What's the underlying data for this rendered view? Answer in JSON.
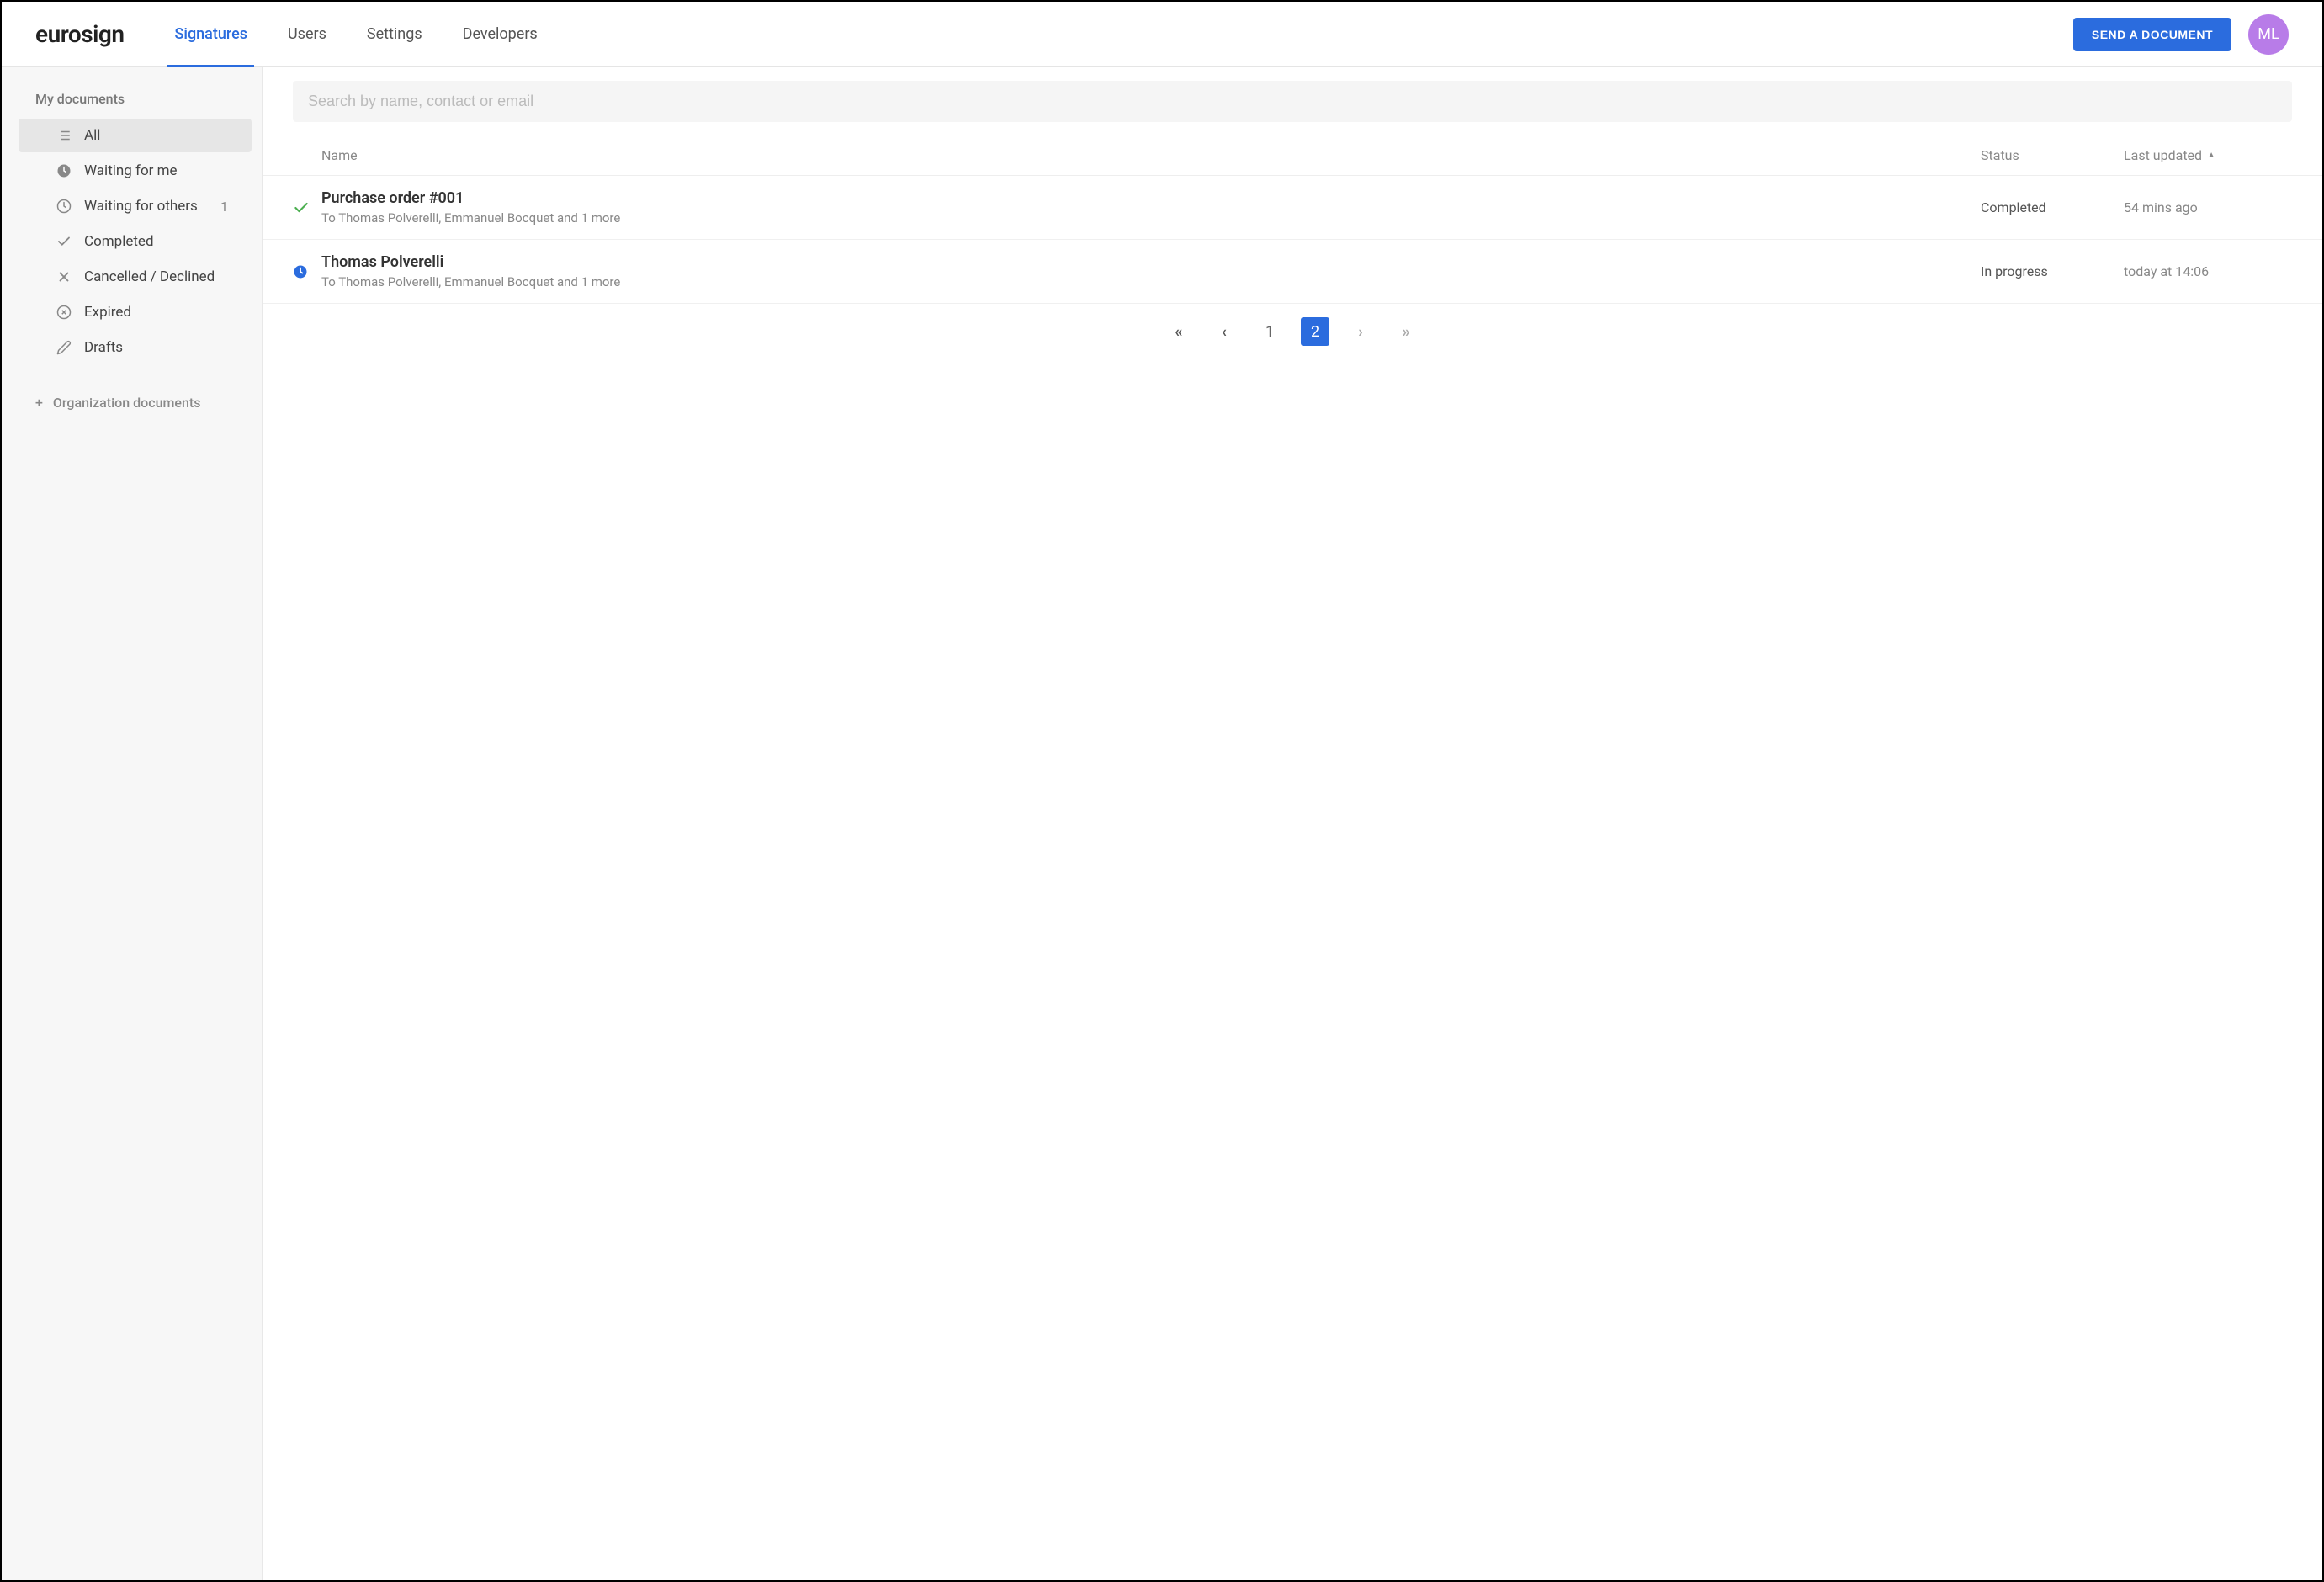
{
  "brand": "eurosign",
  "header": {
    "tabs": [
      {
        "label": "Signatures",
        "active": true
      },
      {
        "label": "Users",
        "active": false
      },
      {
        "label": "Settings",
        "active": false
      },
      {
        "label": "Developers",
        "active": false
      }
    ],
    "send_button": "SEND A DOCUMENT",
    "avatar_initials": "ML"
  },
  "sidebar": {
    "title": "My documents",
    "items": [
      {
        "icon": "list",
        "label": "All",
        "count": null,
        "active": true
      },
      {
        "icon": "clock-solid",
        "label": "Waiting for me",
        "count": null,
        "active": false
      },
      {
        "icon": "clock-outline",
        "label": "Waiting for others",
        "count": "1",
        "active": false
      },
      {
        "icon": "check",
        "label": "Completed",
        "count": null,
        "active": false
      },
      {
        "icon": "x",
        "label": "Cancelled / Declined",
        "count": null,
        "active": false
      },
      {
        "icon": "x-circle",
        "label": "Expired",
        "count": null,
        "active": false
      },
      {
        "icon": "pencil",
        "label": "Drafts",
        "count": null,
        "active": false
      }
    ],
    "org_docs": "Organization documents"
  },
  "search": {
    "placeholder": "Search by name, contact or email"
  },
  "table": {
    "headers": {
      "name": "Name",
      "status": "Status",
      "updated": "Last updated"
    },
    "rows": [
      {
        "icon": "check",
        "title": "Purchase order #001",
        "sub": "To Thomas Polverelli, Emmanuel Bocquet and 1 more",
        "status": "Completed",
        "updated": "54 mins ago"
      },
      {
        "icon": "clock-solid",
        "title": "Thomas Polverelli",
        "sub": "To Thomas Polverelli, Emmanuel Bocquet and 1 more",
        "status": "In progress",
        "updated": "today at 14:06"
      }
    ]
  },
  "pagination": {
    "pages": [
      "1",
      "2"
    ],
    "current": "2"
  }
}
